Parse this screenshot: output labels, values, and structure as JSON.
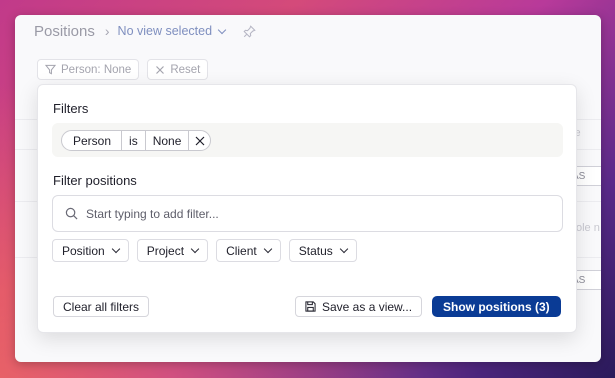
{
  "header": {
    "title": "Positions",
    "view_select": "No view selected"
  },
  "filterbar": {
    "person_pill": "Person: None",
    "reset_label": "Reset"
  },
  "background": {
    "frag1": "ole",
    "chip1": "AS",
    "frag2": "ole n",
    "chip2": "AS"
  },
  "popover": {
    "filters_heading": "Filters",
    "active_filter": {
      "field": "Person",
      "operator": "is",
      "value": "None"
    },
    "filter_positions_heading": "Filter positions",
    "search": {
      "placeholder": "Start typing to add filter...",
      "value": ""
    },
    "dropdowns": [
      "Position",
      "Project",
      "Client",
      "Status"
    ],
    "clear_label": "Clear all filters",
    "save_view_label": "Save as a view...",
    "show_label": "Show positions (3)"
  },
  "colors": {
    "primary": "#0a3b95",
    "link": "#7f8fbf"
  },
  "icons": [
    "chevron-right-icon",
    "chevron-down-icon",
    "pin-icon",
    "filter-icon",
    "close-icon",
    "search-icon",
    "save-icon"
  ]
}
